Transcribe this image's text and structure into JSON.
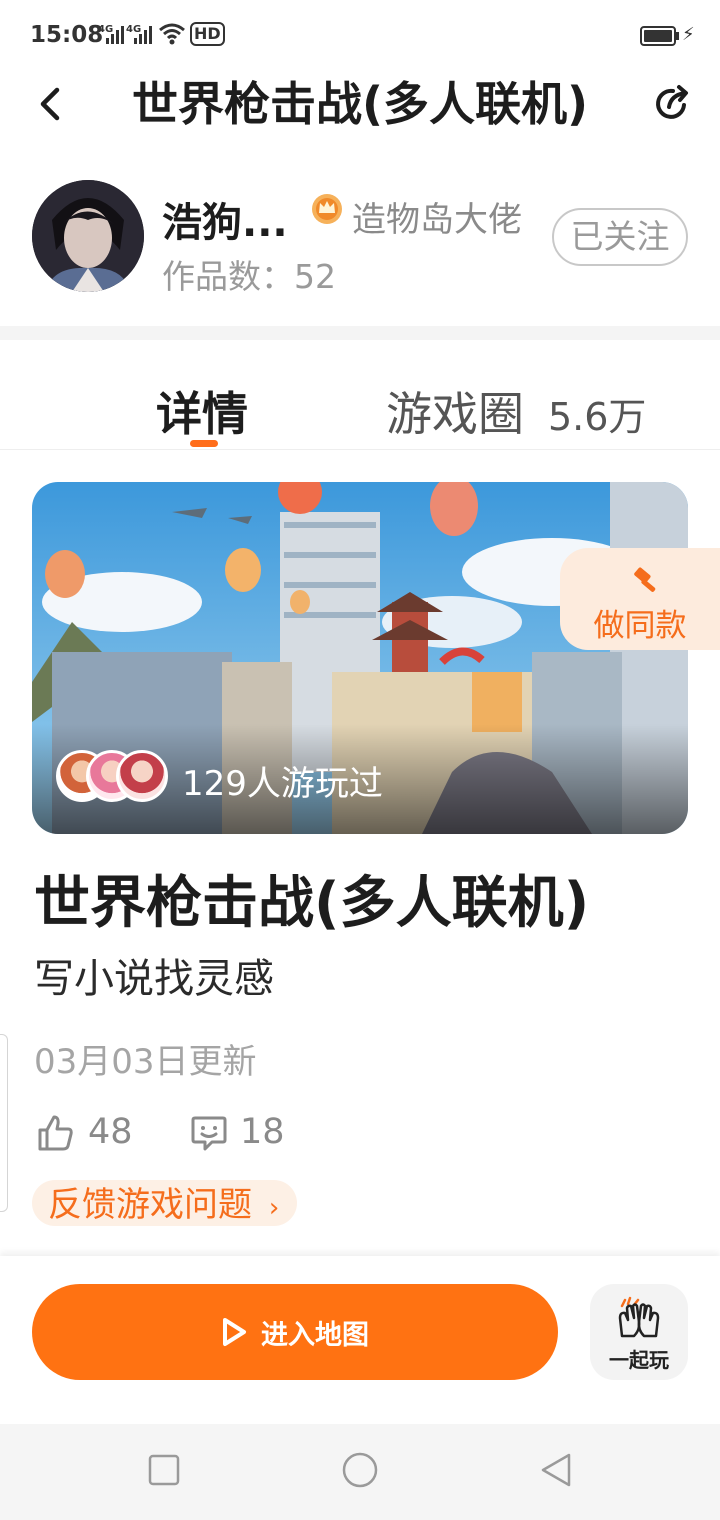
{
  "status_bar": {
    "time": "15:08",
    "sim1": "4G",
    "sim2": "4G",
    "hd": "HD"
  },
  "header": {
    "title": "世界枪击战(多人联机)",
    "back_icon": "chevron-left-icon",
    "share_icon": "share-icon"
  },
  "author": {
    "name": "浩狗...",
    "badge": "造物岛大佬",
    "works_label": "作品数：",
    "works_count": "52",
    "follow_label": "已关注"
  },
  "tabs": {
    "detail": "详情",
    "circle": "游戏圈",
    "circle_count": "5.6万"
  },
  "cover": {
    "played_text": "129人游玩过",
    "remix_label": "做同款"
  },
  "game": {
    "title": "世界枪击战(多人联机)",
    "desc": "写小说找灵感",
    "update": "03月03日更新",
    "likes": "48",
    "comments": "18",
    "feedback": "反馈游戏问题"
  },
  "bottom": {
    "enter_label": "进入地图",
    "together_label": "一起玩"
  },
  "colors": {
    "accent": "#ff7212",
    "accent_soft": "#fdebdd",
    "text_main": "#1d1d1d",
    "text_muted": "#9a9a9a"
  }
}
